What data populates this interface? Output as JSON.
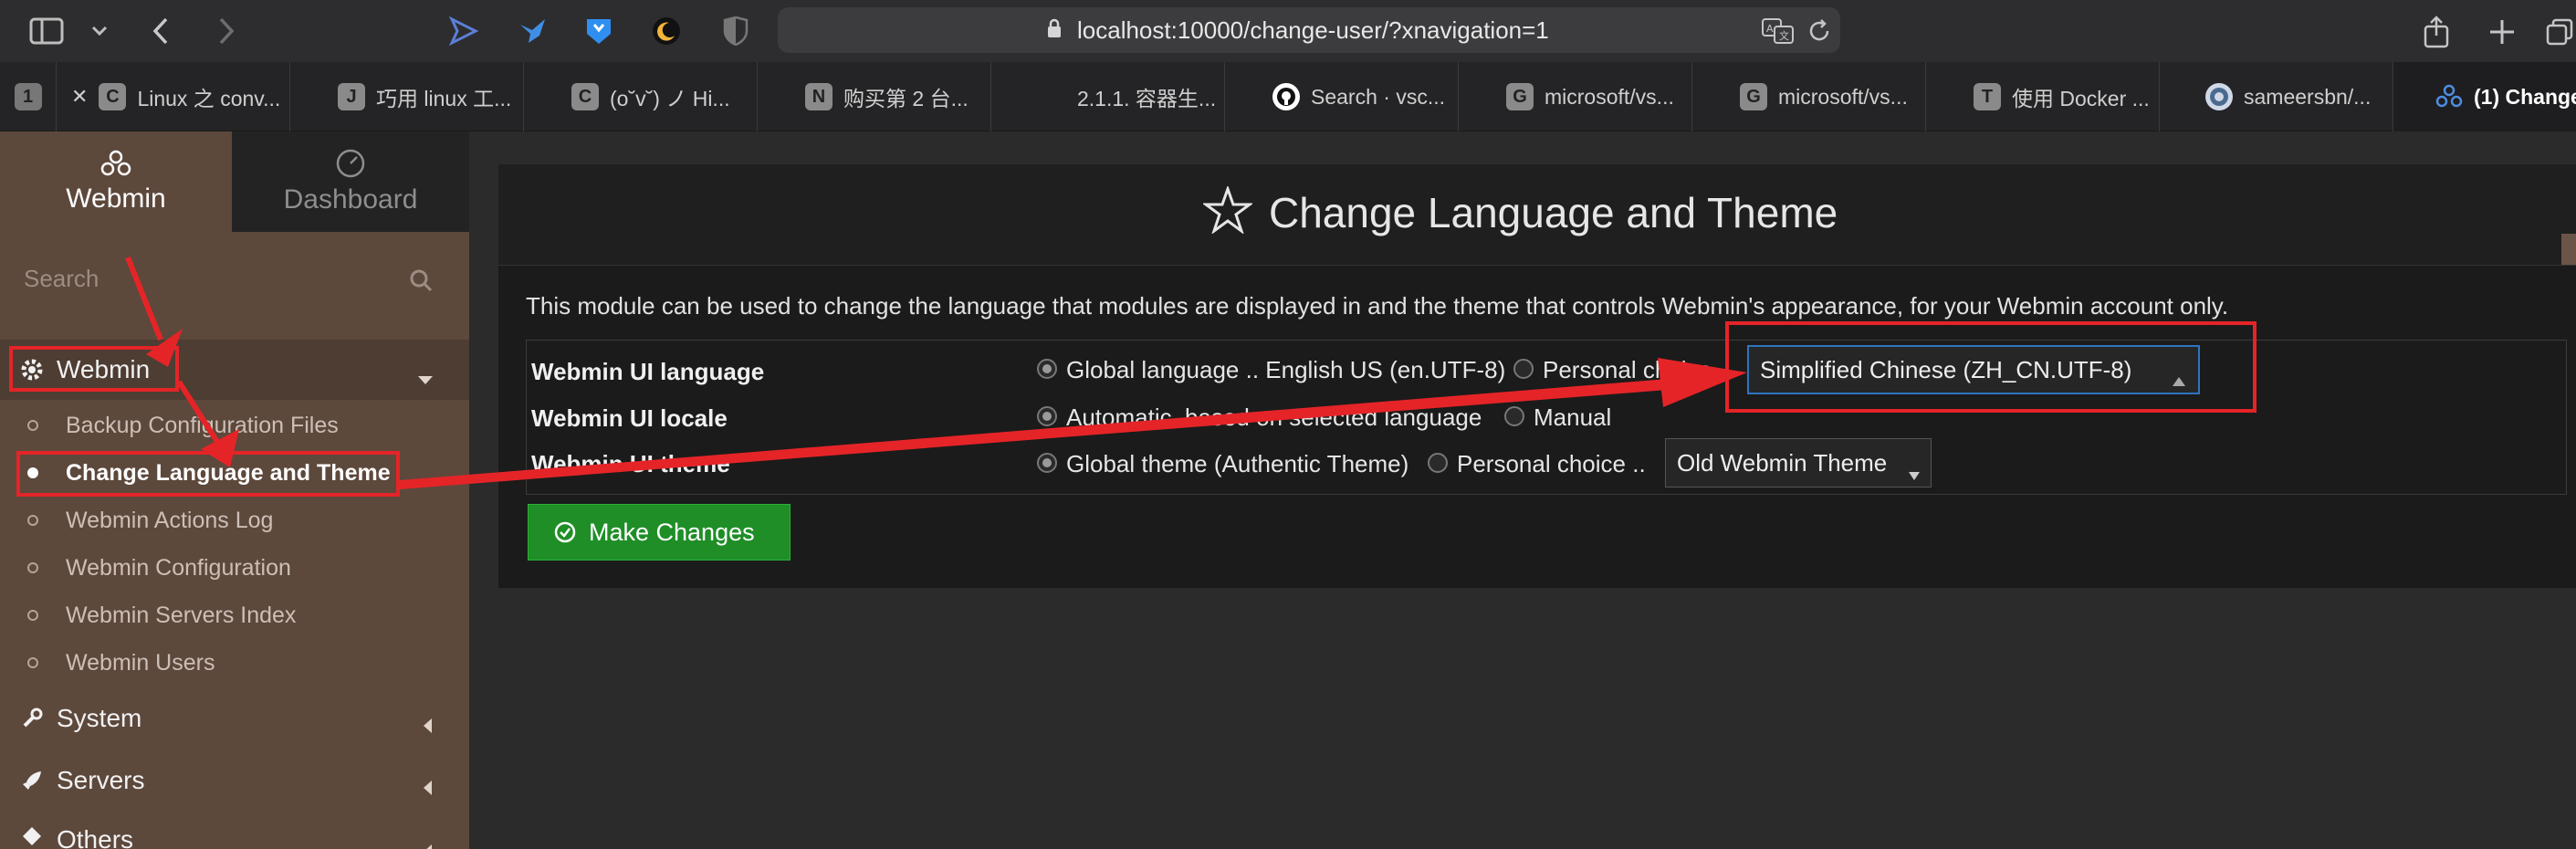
{
  "browser": {
    "url": "localhost:10000/change-user/?xnavigation=1",
    "tabs": [
      {
        "favicon": "1",
        "label": ""
      },
      {
        "favicon": "C",
        "label": "Linux 之 conv..."
      },
      {
        "favicon": "J",
        "label": "巧用 linux 工..."
      },
      {
        "favicon": "C",
        "label": "(o˘v˘) ノ Hi..."
      },
      {
        "favicon": "N",
        "label": "购买第 2 台..."
      },
      {
        "favicon": "",
        "label": "2.1.1. 容器生..."
      },
      {
        "favicon": "",
        "label": "Search · vsc..."
      },
      {
        "favicon": "G",
        "label": "microsoft/vs..."
      },
      {
        "favicon": "G",
        "label": "microsoft/vs..."
      },
      {
        "favicon": "T",
        "label": "使用 Docker ..."
      },
      {
        "favicon": "",
        "label": "sameersbn/..."
      },
      {
        "favicon": "",
        "label": "(1) Change"
      }
    ],
    "close_glyph": "✕"
  },
  "sidebar": {
    "tabs": [
      {
        "label": "Webmin"
      },
      {
        "label": "Dashboard"
      }
    ],
    "search_placeholder": "Search",
    "categories": [
      {
        "label": "Webmin",
        "open": true
      },
      {
        "label": "System"
      },
      {
        "label": "Servers"
      },
      {
        "label": "Others"
      }
    ],
    "webmin_items": [
      {
        "label": "Backup Configuration Files"
      },
      {
        "label": "Change Language and Theme",
        "active": true
      },
      {
        "label": "Webmin Actions Log"
      },
      {
        "label": "Webmin Configuration"
      },
      {
        "label": "Webmin Servers Index"
      },
      {
        "label": "Webmin Users"
      }
    ]
  },
  "main": {
    "title": "Change Language and Theme",
    "description": "This module can be used to change the language that modules are displayed in and the theme that controls Webmin's appearance, for your Webmin account only.",
    "rows": {
      "language": {
        "label": "Webmin UI language",
        "global_option": "Global language .. English US (en.UTF-8)",
        "personal_option": "Personal choice ..",
        "select_value": "Simplified Chinese (ZH_CN.UTF-8)"
      },
      "locale": {
        "label": "Webmin UI locale",
        "auto_option": "Automatic, based on selected language",
        "manual_option": "Manual"
      },
      "theme": {
        "label": "Webmin UI theme",
        "global_option": "Global theme (Authentic Theme)",
        "personal_option": "Personal choice ..",
        "select_value": "Old Webmin Theme"
      }
    },
    "submit_label": "Make Changes"
  },
  "colors": {
    "annotation_red": "#e52427",
    "sidebar_bg": "#5d483c",
    "button_green": "#1f8e27",
    "select_focus": "#2f74c0"
  }
}
